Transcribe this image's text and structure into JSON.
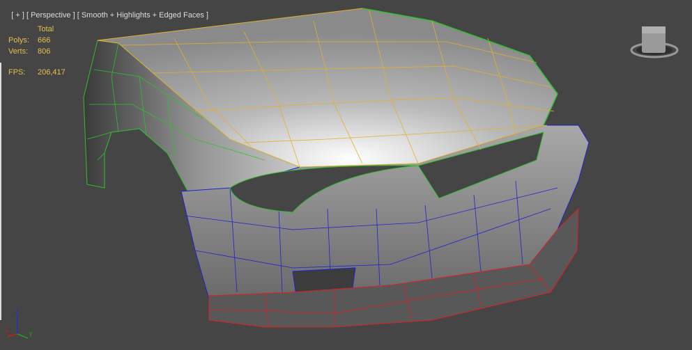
{
  "viewport": {
    "label_parts": [
      "[ + ]",
      "[ Perspective ]",
      "[ Smooth + Highlights + Edged Faces ]"
    ],
    "stats": {
      "header": "Total",
      "polys_label": "Polys:",
      "polys": "666",
      "verts_label": "Verts:",
      "verts": "806",
      "fps_label": "FPS:",
      "fps": "206,417"
    },
    "axis_labels": {
      "x": "x",
      "y": "y",
      "z": "z"
    },
    "colors": {
      "background": "#454545",
      "stats_text": "#e6c24a",
      "hood_wire": "#e0b030",
      "fender_wire": "#30c030",
      "bumper_wire": "#2020d0",
      "lip_wire": "#e02020"
    },
    "icons": [
      "viewcube-icon",
      "axis-tripod-icon"
    ]
  }
}
